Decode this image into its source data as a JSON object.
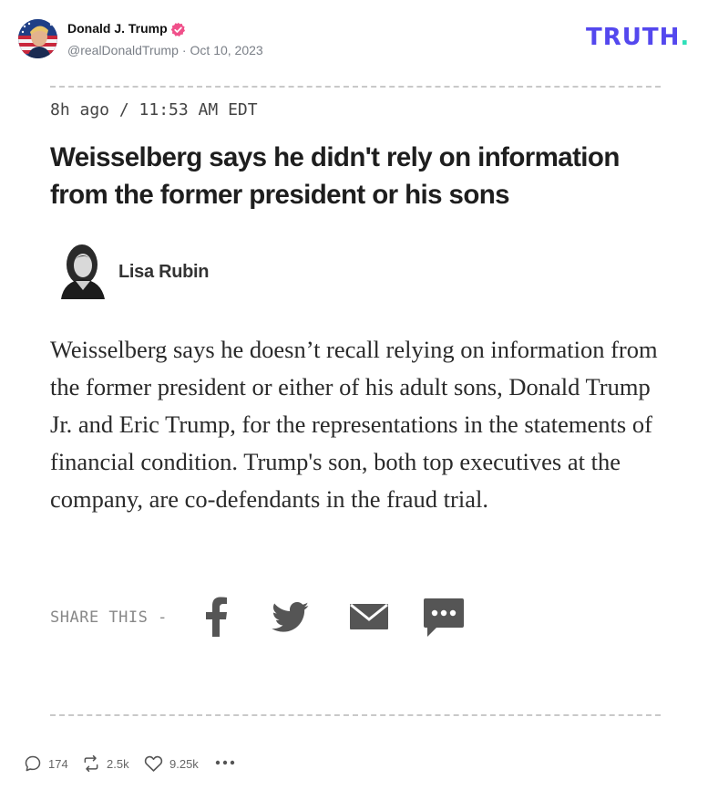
{
  "post": {
    "author_name": "Donald J. Trump",
    "handle": "@realDonaldTrump",
    "separator": "·",
    "date": "Oct 10, 2023"
  },
  "brand": {
    "text": "TRUTH",
    "dot": ".",
    "color": "#5448ee",
    "dot_color": "#2fe0b9"
  },
  "media": {
    "timestamp": "8h ago / 11:53 AM EDT",
    "headline": "Weisselberg says he didn't rely on information from the former president or his sons",
    "byline": "Lisa Rubin",
    "body": "Weisselberg says he doesn’t recall relying on information from the former president or either of his adult sons, Donald Trump Jr. and Eric Trump, for the representations in the statements of financial condition. Trump's son, both top executives at the company, are co-defendants in the fraud trial.",
    "share_label": "SHARE THIS -",
    "share_icons": [
      "facebook-icon",
      "twitter-icon",
      "mail-icon",
      "message-icon"
    ]
  },
  "actions": {
    "replies": "174",
    "retruths": "2.5k",
    "likes": "9.25k",
    "more_icon": "more-dots-icon"
  }
}
